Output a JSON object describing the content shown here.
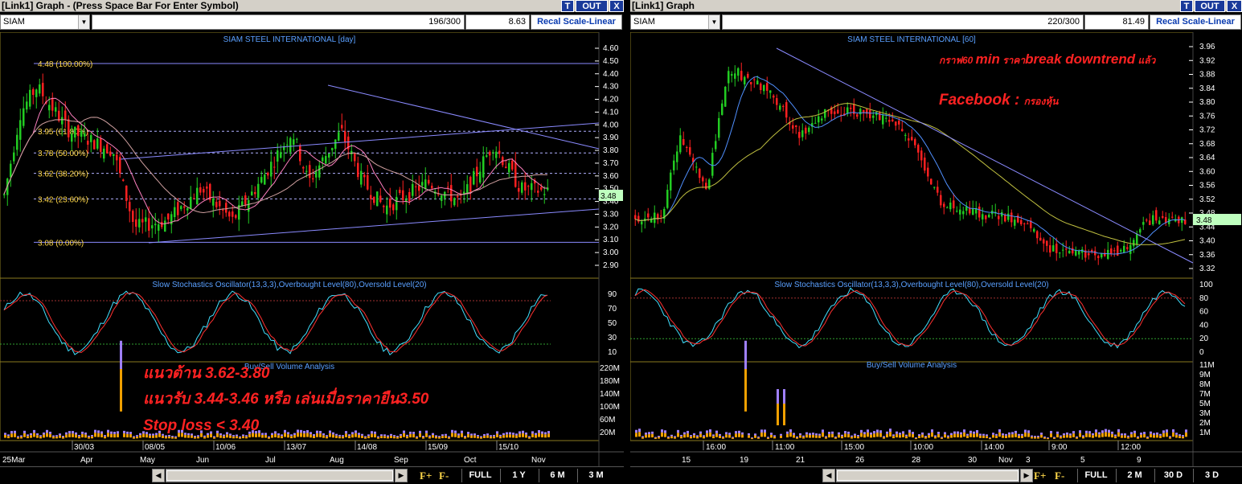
{
  "left": {
    "title": "[Link1] Graph  - (Press Space Bar For Enter Symbol)",
    "btn_t": "T",
    "btn_out": "OUT",
    "btn_x": "X",
    "symbol": "SIAM",
    "count": "196/300",
    "value": "8.63",
    "recal": "Recal Scale-Linear",
    "chart_title": "SIAM STEEL INTERNATIONAL [day]",
    "price_axis": [
      "4.60",
      "4.50",
      "4.40",
      "4.30",
      "4.20",
      "4.10",
      "4.00",
      "3.90",
      "3.80",
      "3.70",
      "3.60",
      "3.50",
      "3.40",
      "3.30",
      "3.20",
      "3.10",
      "3.00",
      "2.90"
    ],
    "current_price": "3.48",
    "fib_labels": [
      "4.48 (100.00%)",
      "3.95 (61.80%)",
      "3.78 (50.00%)",
      "3.62 (38.20%)",
      "3.42 (23.60%)",
      "3.08 (0.00%)"
    ],
    "stoch_title": "Slow Stochastics Oscillator(13,3,3),Overbought Level(80),Oversold Level(20)",
    "stoch_axis": [
      "90",
      "70",
      "50",
      "30",
      "10"
    ],
    "volume_title": "Buy/Sell Volume Analysis",
    "volume_axis": [
      "220M",
      "180M",
      "140M",
      "100M",
      "60M",
      "20M"
    ],
    "date_marks": [
      "30/03",
      "08/05",
      "10/06",
      "13/07",
      "14/08",
      "15/09",
      "15/10"
    ],
    "month_marks": [
      "25Mar",
      "Apr",
      "May",
      "Jun",
      "Jul",
      "Aug",
      "Sep",
      "Oct",
      "Nov"
    ],
    "annotations": [
      "แนวต้าน 3.62-3.80",
      "แนวรับ 3.44-3.46 หรือ เล่นเมื่อราคายืน3.50",
      "Stop loss < 3.40"
    ],
    "fplus": "F+",
    "fminus": "F-",
    "periods": [
      "FULL",
      "1 Y",
      "6 M",
      "3 M"
    ]
  },
  "right": {
    "title": "[Link1] Graph",
    "btn_t": "T",
    "btn_out": "OUT",
    "btn_x": "X",
    "symbol": "SIAM",
    "count": "220/300",
    "value": "81.49",
    "recal": "Recal Scale-Linear",
    "chart_title": "SIAM STEEL INTERNATIONAL [60]",
    "price_axis": [
      "3.96",
      "3.92",
      "3.88",
      "3.84",
      "3.80",
      "3.76",
      "3.72",
      "3.68",
      "3.64",
      "3.60",
      "3.56",
      "3.52",
      "3.48",
      "3.44",
      "3.40",
      "3.36",
      "3.32"
    ],
    "current_price": "3.48",
    "annot1_a": "กราฟ60 ",
    "annot1_b": "min",
    "annot1_c": " ราคา",
    "annot1_d": "break downtrend",
    "annot1_e": " แล้ว",
    "annot2_a": "Facebook : ",
    "annot2_b": "กรองหุ้น",
    "stoch_title": "Slow Stochastics Oscillator(13,3,3),Overbought Level(80),Oversold Level(20)",
    "stoch_axis": [
      "100",
      "80",
      "60",
      "40",
      "20",
      "0"
    ],
    "volume_title": "Buy/Sell Volume Analysis",
    "volume_axis": [
      "11M",
      "9M",
      "8M",
      "7M",
      "5M",
      "3M",
      "2M",
      "1M"
    ],
    "time_marks": [
      "16:00",
      "11:00",
      "15:00",
      "10:00",
      "14:00",
      "9:00",
      "12:00"
    ],
    "day_marks": [
      "15",
      "19",
      "21",
      "26",
      "28",
      "30",
      "Nov",
      "3",
      "5",
      "9"
    ],
    "fplus": "F+",
    "fminus": "F-",
    "periods": [
      "FULL",
      "2 M",
      "30 D",
      "3 D"
    ]
  },
  "colors": {
    "up": "#22cc22",
    "down": "#ff2020",
    "axis": "#ffd84a",
    "title": "#5aa0ff",
    "trend": "#8a8aff",
    "annot": "#ff2222"
  }
}
